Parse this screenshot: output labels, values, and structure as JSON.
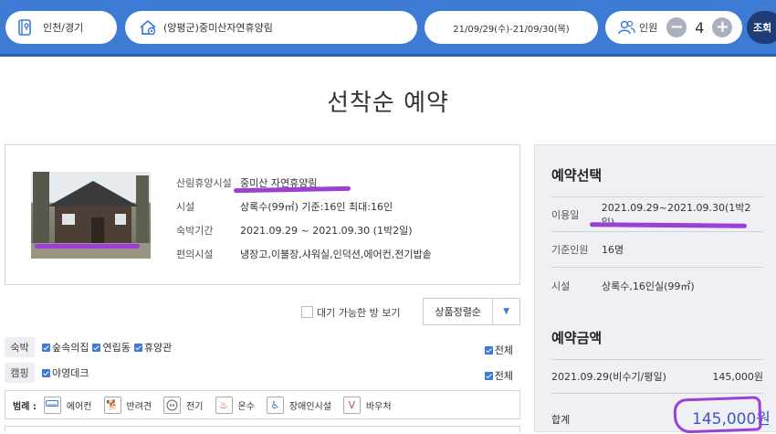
{
  "search": {
    "region": "인천/경기",
    "forest": "(양평군)중미산자연휴양림",
    "date_range": "21/09/29(수)-21/09/30(목)",
    "people_label": "인원",
    "people_count": "4",
    "minus": "−",
    "plus": "+",
    "search_button": "조회"
  },
  "page_title": "선착순 예약",
  "forest_info": {
    "rows": [
      {
        "label": "산림휴양시설",
        "value": "중미산 자연휴양림"
      },
      {
        "label": "시설",
        "value": "상록수(99㎡) 기준:16인 최대:16인"
      },
      {
        "label": "숙박기간",
        "value": "2021.09.29 ~ 2021.09.30 (1박2일)"
      },
      {
        "label": "편의시설",
        "value": "냉장고,이불장,샤워실,인덕션,에어컨,전기밥솥"
      }
    ]
  },
  "filters": {
    "available_only_label": "대기 가능한 방 보기",
    "sort_selected": "상품정렬순"
  },
  "categories": {
    "lodging": {
      "tag": "숙박",
      "options": [
        "숲속의집",
        "연립동",
        "휴양관"
      ],
      "all_label": "전체"
    },
    "camping": {
      "tag": "캠핑",
      "options": [
        "야영데크"
      ],
      "all_label": "전체"
    }
  },
  "legend": {
    "title": "범례 :",
    "items": [
      "에어컨",
      "반려견",
      "전기",
      "온수",
      "장애인시설",
      "바우처"
    ],
    "colors": {
      "aircon": "#3d7bd4",
      "pet": "#8a3fb8",
      "electric": "#666666",
      "hotwater": "#d9342b",
      "accessible": "#2d78c9",
      "voucher": "#c03a8e"
    }
  },
  "reservation": {
    "title": "예약선택",
    "period_label": "이용일",
    "period_value": "2021.09.29~2021.09.30(1박2일)",
    "base_people_label": "기준인원",
    "base_people_value": "16명",
    "facility_label": "시설",
    "facility_value": "상록수,16인실(99㎡)"
  },
  "price": {
    "title": "예약금액",
    "line_label": "2021.09.29(비수기/평일)",
    "line_value": "145,000원",
    "total_label": "합계",
    "total_value": "145,000원"
  },
  "colors": {
    "header": "#3d7bd4",
    "accent": "#3d56c9",
    "annotation": "#9b3fd6"
  }
}
